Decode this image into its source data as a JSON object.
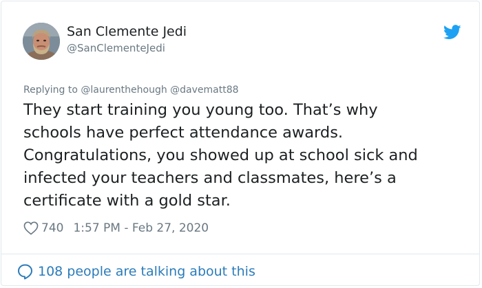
{
  "tweet": {
    "display_name": "San Clemente Jedi",
    "handle": "@SanClementeJedi",
    "reply_prefix": "Replying to",
    "reply_mentions": [
      "@laurenthehough",
      "@davematt88"
    ],
    "text_lines": [
      "They start training you young too.  That’s why",
      "schools have perfect attendance awards.",
      "Congratulations, you showed up at school sick and",
      "infected your teachers and classmates, here’s a",
      "certificate with a gold star."
    ],
    "like_count": "740",
    "timestamp": "1:57 PM - Feb 27, 2020",
    "footer_text": "108 people are talking about this"
  },
  "icons": {
    "logo": "twitter-bird-icon",
    "like": "heart-icon",
    "conversation": "speech-bubble-icon"
  },
  "colors": {
    "twitter_blue": "#1da1f2",
    "link_blue": "#2b7bb9",
    "text_primary": "#1c2022",
    "text_secondary": "#697882",
    "border": "#e1e8ed"
  }
}
